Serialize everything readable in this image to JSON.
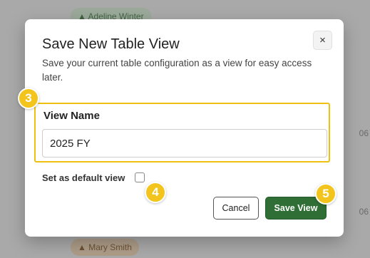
{
  "background": {
    "pill_top": "▲ Adeline Winter",
    "pill_bottom": "▲ Mary Smith",
    "edge_text_1": "06",
    "edge_text_2": "06"
  },
  "modal": {
    "title": "Save New Table View",
    "description": "Save your current table configuration as a view for easy access later.",
    "close_label": "×",
    "field": {
      "label": "View Name",
      "value": "2025 FY",
      "placeholder": ""
    },
    "default_checkbox": {
      "label": "Set as default view",
      "checked": false
    },
    "cancel_label": "Cancel",
    "save_label": "Save View"
  },
  "markers": {
    "field_step": "3",
    "checkbox_step": "4",
    "save_step": "5"
  },
  "colors": {
    "highlight": "#f0c010",
    "save_button": "#2f6e35",
    "marker": "#f3c51c"
  }
}
